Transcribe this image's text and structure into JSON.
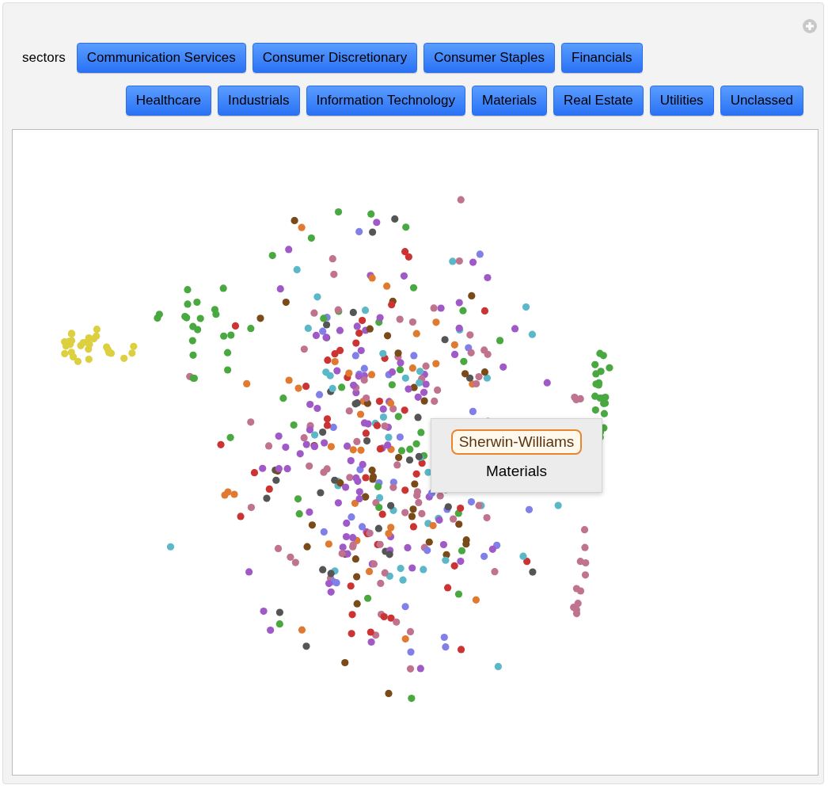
{
  "controls": {
    "label": "sectors",
    "button_rows": [
      {
        "buttons": [
          "Communication Services",
          "Consumer Discretionary",
          "Consumer Staples",
          "Financials"
        ]
      },
      {
        "buttons": [
          "Healthcare",
          "Industrials",
          "Information Technology",
          "Materials",
          "Real Estate",
          "Utilities",
          "Unclassed"
        ]
      }
    ]
  },
  "tooltip": {
    "title": "Sherwin-Williams",
    "subtitle": "Materials"
  }
}
